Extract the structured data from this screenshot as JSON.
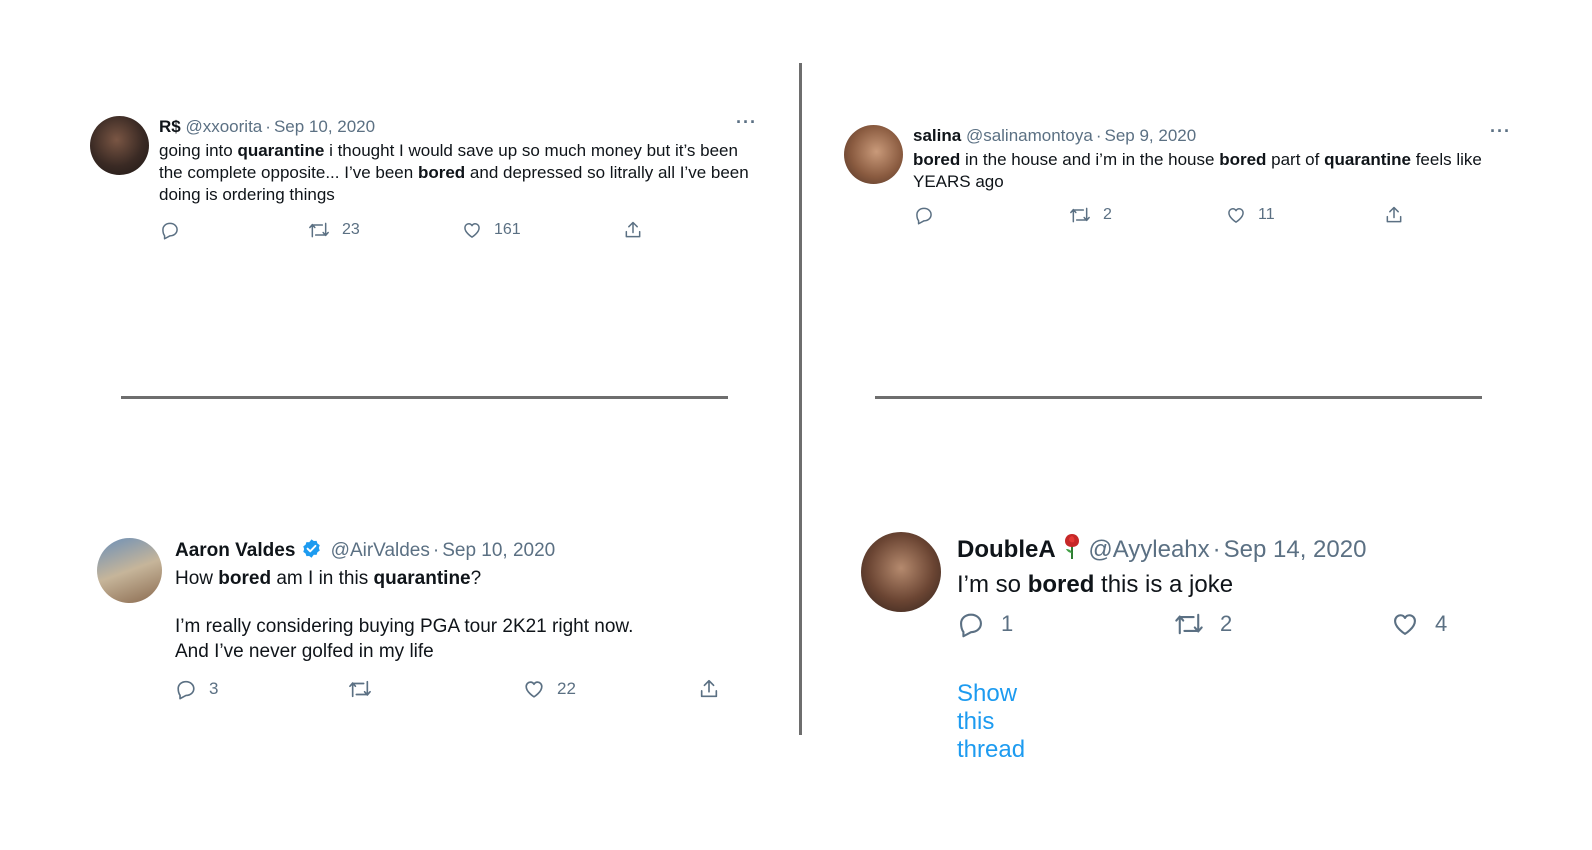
{
  "tweets": [
    {
      "display_name": "R$",
      "handle": "@xxoorita",
      "date": "Sep 10, 2020",
      "more": "···",
      "text_segments": [
        {
          "t": "going into ",
          "b": false
        },
        {
          "t": "quarantine",
          "b": true
        },
        {
          "t": " i thought I would save up so much money but it’s been the complete opposite... I’ve been ",
          "b": false
        },
        {
          "t": "bored",
          "b": true
        },
        {
          "t": " and depressed so litrally all I’ve been doing is ordering things",
          "b": false
        }
      ],
      "reply_count": "",
      "retweet_count": "23",
      "like_count": "161"
    },
    {
      "display_name": "salina",
      "handle": "@salinamontoya",
      "date": "Sep 9, 2020",
      "more": "···",
      "text_segments": [
        {
          "t": "bored",
          "b": true
        },
        {
          "t": " in the house and i’m in the house ",
          "b": false
        },
        {
          "t": "bored",
          "b": true
        },
        {
          "t": " part of ",
          "b": false
        },
        {
          "t": "quarantine",
          "b": true
        },
        {
          "t": " feels like YEARS ago",
          "b": false
        }
      ],
      "reply_count": "",
      "retweet_count": "2",
      "like_count": "11"
    },
    {
      "display_name": "Aaron Valdes",
      "verified": true,
      "handle": "@AirValdes",
      "date": "Sep 10, 2020",
      "line1_segments": [
        {
          "t": "How ",
          "b": false
        },
        {
          "t": "bored",
          "b": true
        },
        {
          "t": " am I in this ",
          "b": false
        },
        {
          "t": "quarantine",
          "b": true
        },
        {
          "t": "?",
          "b": false
        }
      ],
      "line2": "I’m really considering buying PGA tour 2K21 right now.",
      "line3": "And I’ve never golfed in my life",
      "reply_count": "3",
      "retweet_count": "",
      "like_count": "22"
    },
    {
      "display_name": "DoubleA",
      "handle": "@Ayyleahx",
      "date": "Sep 14, 2020",
      "text_segments": [
        {
          "t": "I’m so ",
          "b": false
        },
        {
          "t": "bored",
          "b": true
        },
        {
          "t": " this is a joke",
          "b": false
        }
      ],
      "reply_count": "1",
      "retweet_count": "2",
      "like_count": "4",
      "show_thread": "Show this thread"
    }
  ],
  "icons": {
    "reply": "reply-icon",
    "retweet": "retweet-icon",
    "like": "heart-icon",
    "share": "share-icon",
    "verified": "verified-badge-icon",
    "rose": "rose-emoji-icon"
  },
  "colors": {
    "secondary_text": "#5b7083",
    "link": "#1d9bf0",
    "verified": "#1d9bf0",
    "divider": "#6e6e6e"
  }
}
